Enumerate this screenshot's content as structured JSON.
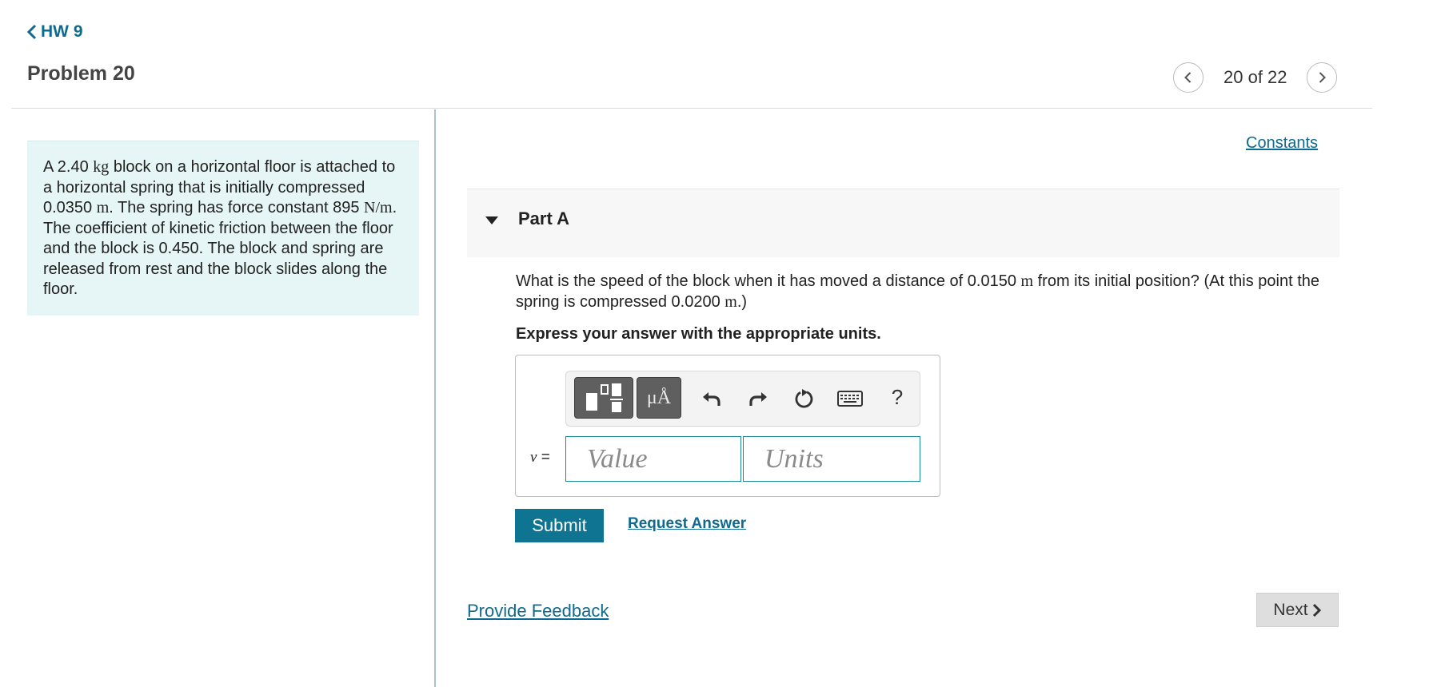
{
  "header": {
    "back_label": "HW 9",
    "problem_title": "Problem 20",
    "page_count": "20 of 22"
  },
  "statement": {
    "text_1": "A 2.40 ",
    "unit_1": "kg",
    "text_2": " block on a horizontal floor is attached to a horizontal spring that is initially compressed 0.0350 ",
    "unit_2": "m",
    "text_3": ". The spring has force constant 895 ",
    "unit_3": "N/m",
    "text_4": ". The coefficient of kinetic friction between the floor and the block is 0.450. The block and spring are released from rest and the block slides along the floor."
  },
  "constants_label": "Constants",
  "part": {
    "title": "Part A",
    "question_1": "What is the speed of the block when it has moved a distance of 0.0150 ",
    "q_unit_1": "m",
    "question_2": " from its initial position? (At this point the spring is compressed 0.0200 ",
    "q_unit_2": "m",
    "question_3": ".)",
    "instruction": "Express your answer with the appropriate units."
  },
  "answer": {
    "units_tool_label": "μÅ",
    "help_label": "?",
    "variable": "v",
    "equals": " =",
    "value_placeholder": "Value",
    "units_placeholder": "Units"
  },
  "actions": {
    "submit_label": "Submit",
    "request_label": "Request Answer",
    "feedback_label": "Provide Feedback",
    "next_label": "Next"
  },
  "colors": {
    "link": "#0f6a8f",
    "submit_bg": "#0f7491",
    "statement_bg": "#e6f5f5",
    "input_border": "#188a9a"
  }
}
